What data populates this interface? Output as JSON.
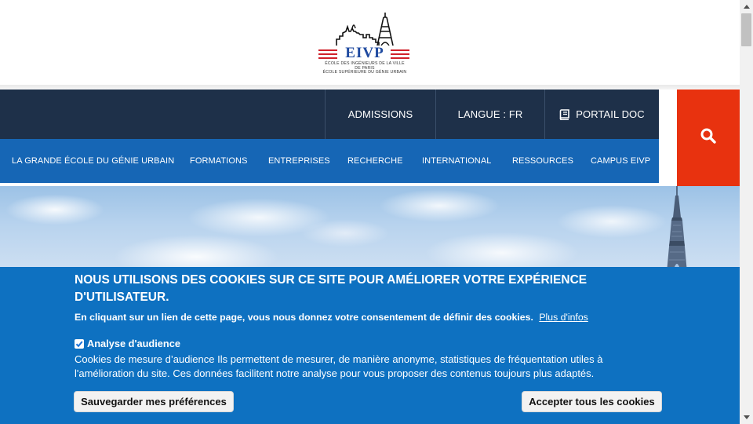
{
  "logo": {
    "wordmark": "EIVP",
    "subtitle_line1": "ÉCOLE DES INGÉNIEURS DE LA VILLE",
    "subtitle_line2": "DE PARIS",
    "subtitle_line3": "ÉCOLE SUPÉRIEURE DU GÉNIE URBAIN",
    "icon": "paris-skyline-eiffel-tower"
  },
  "top_nav": {
    "admissions": "ADMISSIONS",
    "langue": "LANGUE : FR",
    "portail": "PORTAIL DOC",
    "portail_icon": "book-icon"
  },
  "search": {
    "icon": "search-icon"
  },
  "main_nav": {
    "items": [
      "LA GRANDE ÉCOLE DU GÉNIE URBAIN",
      "FORMATIONS",
      "ENTREPRISES",
      "RECHERCHE",
      "INTERNATIONAL",
      "RESSOURCES",
      "CAMPUS EIVP"
    ]
  },
  "cookie": {
    "title": "NOUS UTILISONS DES COOKIES SUR CE SITE POUR AMÉLIORER VOTRE EXPÉRIENCE D'UTILISATEUR.",
    "consent_text": "En cliquant sur un lien de cette page, vous nous donnez votre consentement de définir des cookies.",
    "more_link": "Plus d'infos",
    "checkbox_label": "Analyse d'audience",
    "checkbox_checked": true,
    "description": "Cookies de mesure d’audience Ils permettent de mesurer, de manière anonyme, statistiques de fréquentation utiles à l'amélioration du site. Ces données facilitent notre analyse pour vous proposer des contenus toujours plus adaptés.",
    "save_button": "Sauvegarder mes préférences",
    "accept_button": "Accepter tous les cookies"
  },
  "colors": {
    "top_nav_bg": "#1e3049",
    "main_nav_bg": "#1666b5",
    "search_bg": "#e8320f",
    "cookie_bg": "#0e71c1",
    "logo_blue": "#1f4aa0",
    "logo_red": "#d0202a"
  }
}
